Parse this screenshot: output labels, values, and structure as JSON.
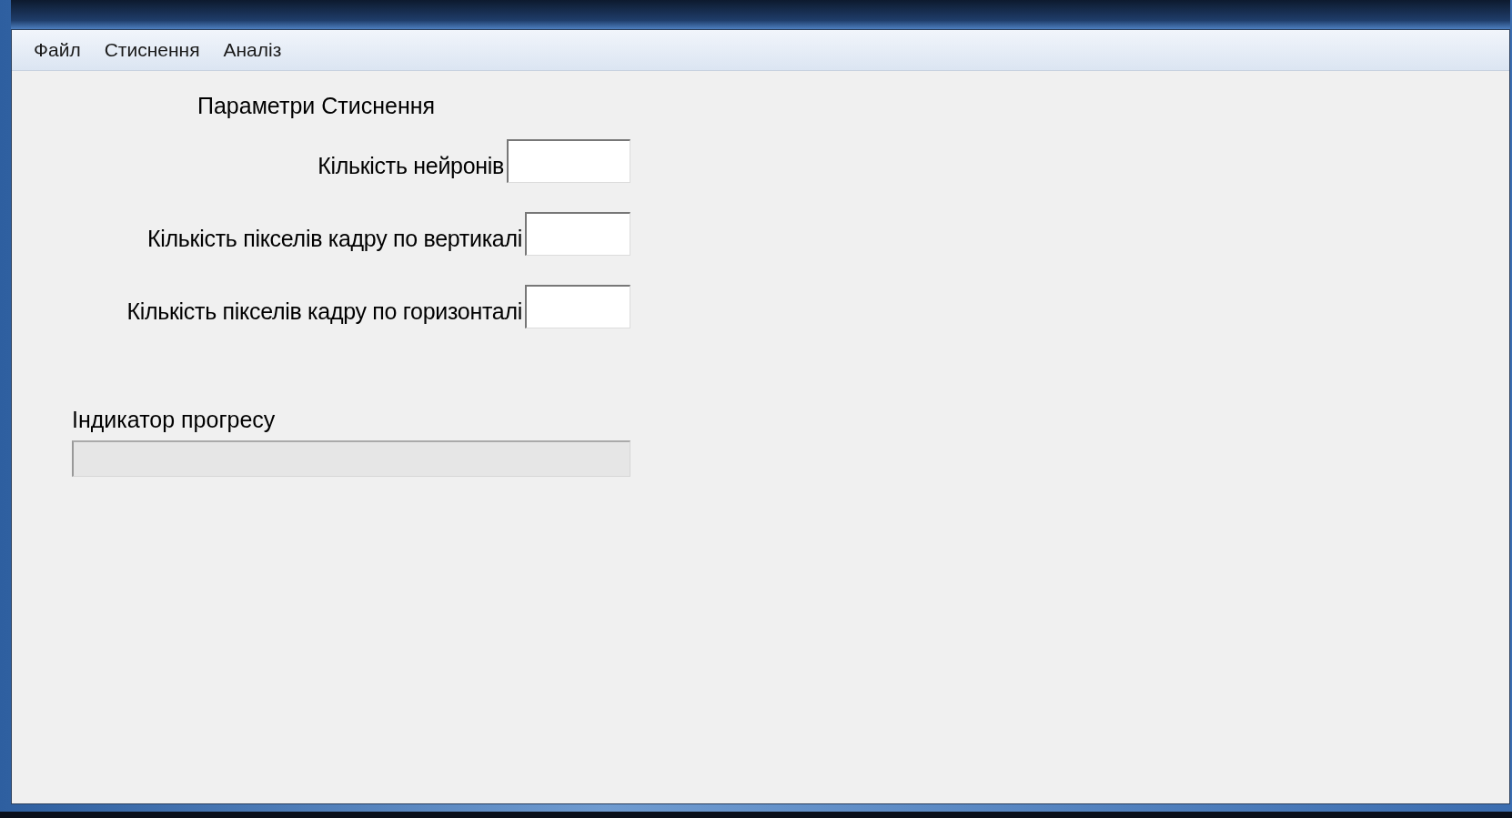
{
  "menu": [
    "Файл",
    "Стиснення",
    "Аналіз"
  ],
  "form": {
    "title": "Параметри Стиснення",
    "fields": [
      {
        "label": "Кількість нейронів"
      },
      {
        "label": "Кількість пікселів кадру по вертикалі"
      },
      {
        "label": "Кількість пікселів кадру по горизонталі"
      }
    ]
  },
  "progress": {
    "label": "Індикатор прогресу",
    "level": 0
  }
}
